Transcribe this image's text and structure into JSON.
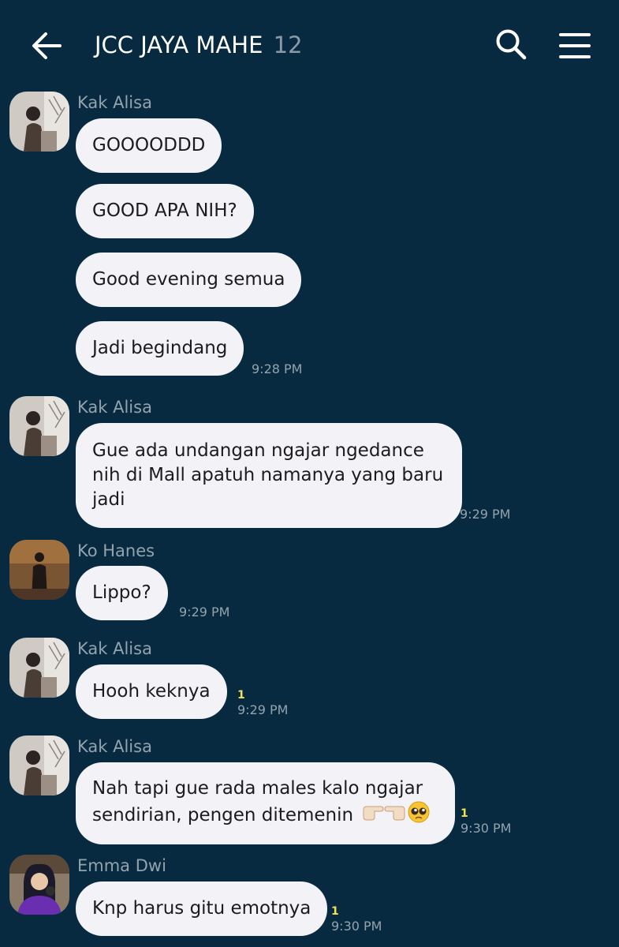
{
  "header": {
    "title": "JCC JAYA MAHE",
    "member_count": "12",
    "back_icon": "arrow-left-icon",
    "search_icon": "search-icon",
    "menu_icon": "hamburger-menu-icon"
  },
  "colors": {
    "background": "#082a40",
    "bubble": "#f2f2f7",
    "bubble_text": "#1c1c1e",
    "muted_text": "#93a3ad",
    "read_count": "#f2e34c"
  },
  "messages": [
    {
      "sender": "Kak Alisa",
      "bubbles": [
        "GOOOODDD",
        "GOOD APA NIH?",
        "Good evening semua",
        "Jadi begindang"
      ],
      "time": "9:28 PM"
    },
    {
      "sender": "Kak Alisa",
      "bubbles": [
        "Gue ada undangan ngajar ngedance\nnih di Mall apatuh namanya yang baru\njadi"
      ],
      "time": "9:29 PM"
    },
    {
      "sender": "Ko Hanes",
      "bubbles": [
        "Lippo?"
      ],
      "time": "9:29 PM"
    },
    {
      "sender": "Kak Alisa",
      "bubbles": [
        "Hooh keknya"
      ],
      "read_count": "1",
      "time": "9:29 PM"
    },
    {
      "sender": "Kak Alisa",
      "bubbles": [
        "Nah tapi gue rada males kalo ngajar",
        "sendirian, pengen ditemenin"
      ],
      "emojis": [
        "pointing-right-emoji",
        "pointing-left-emoji",
        "pleading-face-emoji"
      ],
      "read_count": "1",
      "time": "9:30 PM"
    },
    {
      "sender": "Emma Dwi",
      "bubbles": [
        "Knp harus gitu emotnya"
      ],
      "read_count": "1",
      "time": "9:30 PM"
    }
  ]
}
